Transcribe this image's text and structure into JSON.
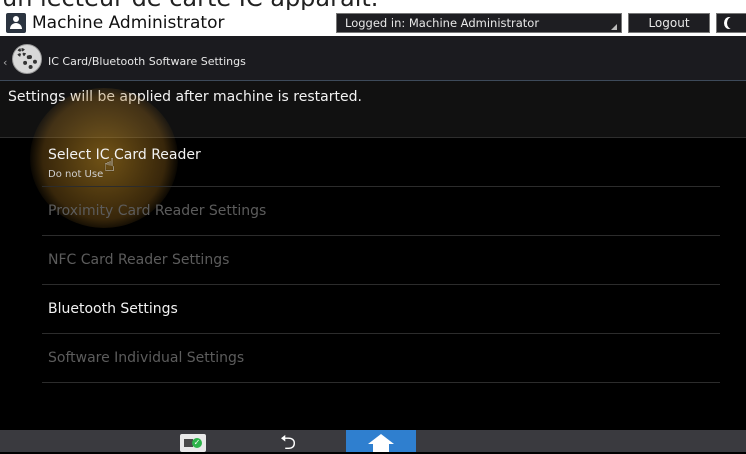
{
  "caption": {
    "text": "un lecteur de carte IC apparaît."
  },
  "header": {
    "title": "Machine Administrator",
    "logged_in": "Logged in: Machine Administrator",
    "logout_label": "Logout"
  },
  "breadcrumb": {
    "title": "IC Card/Bluetooth Software Settings"
  },
  "notice": "Settings will be applied after machine is restarted.",
  "menu": {
    "items": [
      {
        "label": "Select IC Card Reader",
        "sub": "Do not Use",
        "enabled": true
      },
      {
        "label": "Proximity Card Reader Settings",
        "enabled": false
      },
      {
        "label": "NFC Card Reader Settings",
        "enabled": false
      },
      {
        "label": "Bluetooth Settings",
        "enabled": true
      },
      {
        "label": "Software Individual Settings",
        "enabled": false
      }
    ]
  },
  "colors": {
    "accent": "#2f7fcf",
    "background": "#000000",
    "highlight": "#c8922c"
  },
  "icons": {
    "user": "user-icon",
    "settings": "gear-icon",
    "moon": "moon-icon",
    "home": "home-icon",
    "return": "return-arrow-icon",
    "scan": "scan-status-icon"
  }
}
